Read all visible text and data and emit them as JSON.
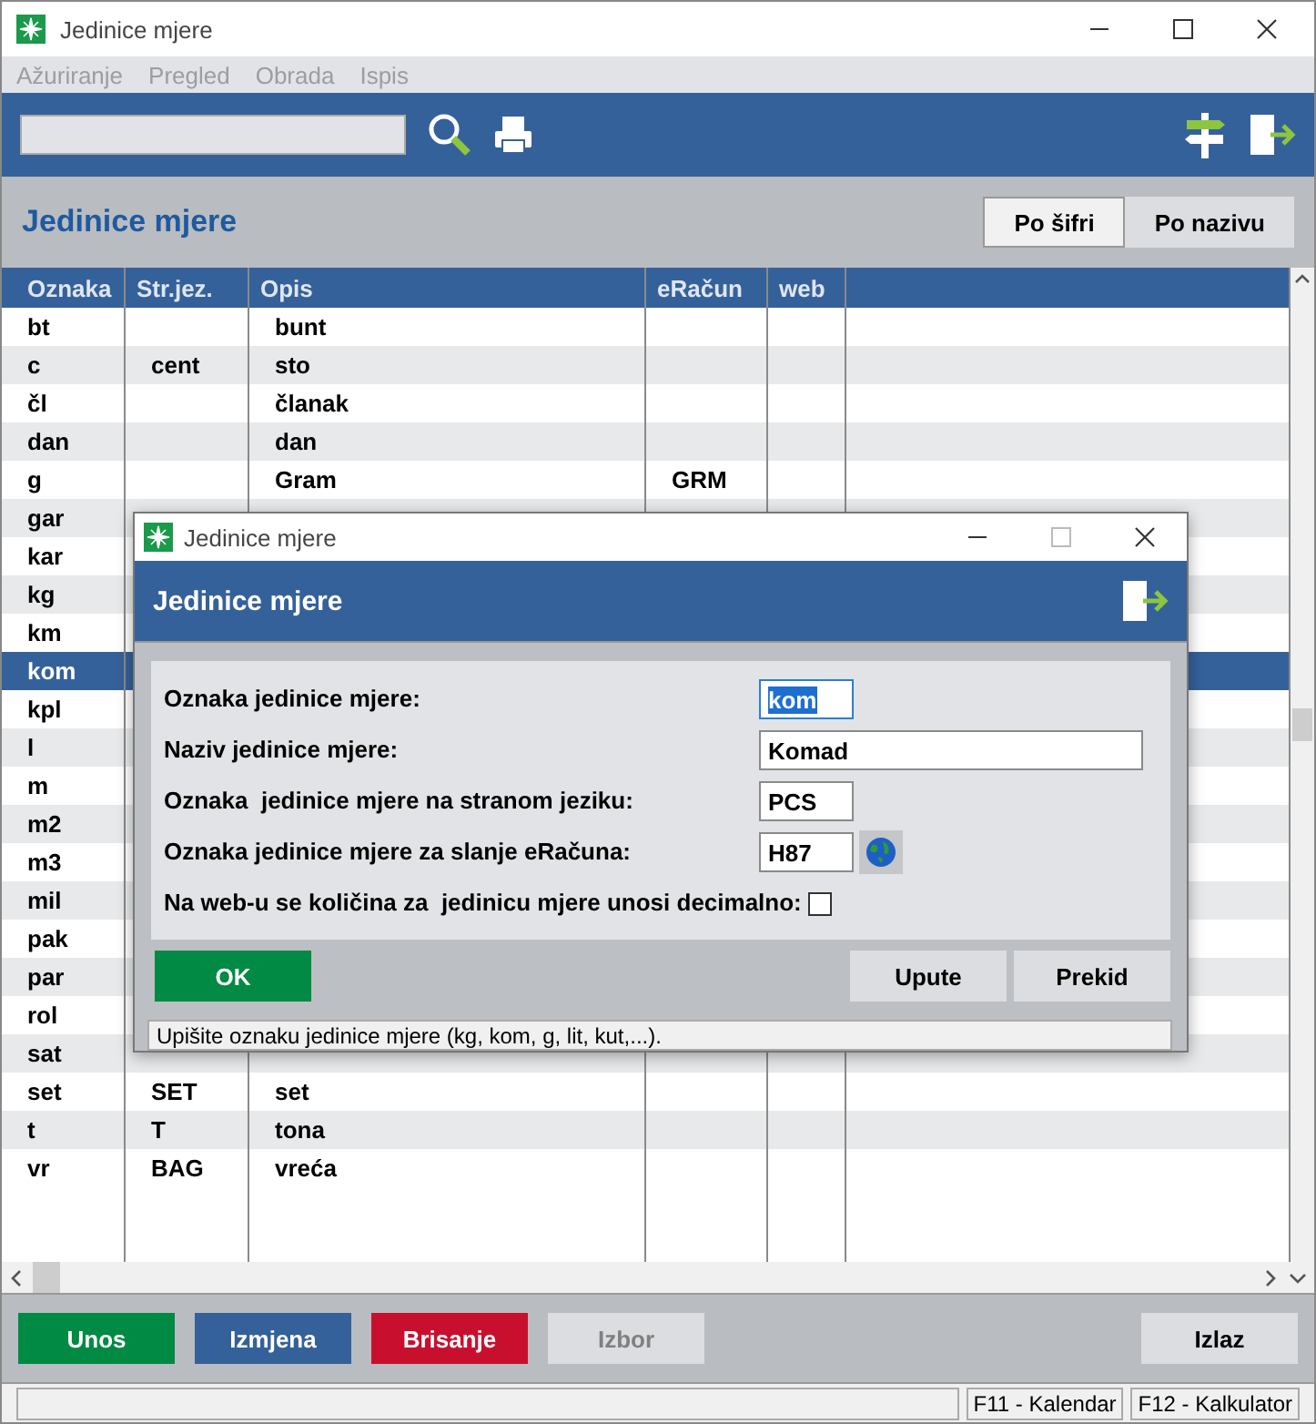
{
  "window": {
    "title": "Jedinice mjere"
  },
  "menu": [
    {
      "label": "Ažuriranje",
      "disabled": true
    },
    {
      "label": "Pregled",
      "disabled": true
    },
    {
      "label": "Obrada",
      "disabled": true
    },
    {
      "label": "Ispis",
      "disabled": true
    }
  ],
  "header": {
    "title": "Jedinice mjere",
    "sort_tabs": [
      {
        "label": "Po šifri",
        "selected": true
      },
      {
        "label": "Po nazivu",
        "selected": false
      }
    ]
  },
  "table": {
    "columns": [
      "Oznaka",
      "Str.jez.",
      "Opis",
      "eRačun",
      "web"
    ],
    "rows": [
      {
        "oznaka": "bt",
        "opis": "bunt",
        "selected": false
      },
      {
        "oznaka": "c",
        "str_jez": "cent",
        "opis": "sto",
        "selected": false
      },
      {
        "oznaka": "čl",
        "opis": "članak",
        "selected": false
      },
      {
        "oznaka": "dan",
        "opis": "dan",
        "selected": false
      },
      {
        "oznaka": "g",
        "opis": "Gram",
        "eracun": "GRM",
        "selected": false
      },
      {
        "oznaka": "gar",
        "selected": false
      },
      {
        "oznaka": "kar",
        "selected": false
      },
      {
        "oznaka": "kg",
        "selected": false
      },
      {
        "oznaka": "km",
        "selected": false
      },
      {
        "oznaka": "kom",
        "selected": true
      },
      {
        "oznaka": "kpl",
        "selected": false
      },
      {
        "oznaka": "l",
        "selected": false
      },
      {
        "oznaka": "m",
        "selected": false
      },
      {
        "oznaka": "m2",
        "selected": false
      },
      {
        "oznaka": "m3",
        "selected": false
      },
      {
        "oznaka": "mil",
        "selected": false
      },
      {
        "oznaka": "pak",
        "selected": false
      },
      {
        "oznaka": "par",
        "selected": false
      },
      {
        "oznaka": "rol",
        "selected": false
      },
      {
        "oznaka": "sat",
        "selected": false
      },
      {
        "oznaka": "set",
        "str_jez": "SET",
        "opis": "set",
        "selected": false
      },
      {
        "oznaka": "t",
        "str_jez": "T",
        "opis": "tona",
        "selected": false
      },
      {
        "oznaka": "vr",
        "str_jez": "BAG",
        "opis": "vreća",
        "selected": false
      }
    ]
  },
  "buttons": [
    {
      "label": "Unos",
      "kind": "add",
      "disabled": false
    },
    {
      "label": "Izmjena",
      "kind": "edit",
      "disabled": false
    },
    {
      "label": "Brisanje",
      "kind": "delete",
      "disabled": false
    },
    {
      "label": "Izbor",
      "kind": "plain",
      "disabled": true
    },
    {
      "label": "Izlaz",
      "kind": "exit",
      "disabled": false
    }
  ],
  "status_bar": [
    "F11 - Kalendar",
    "F12 - Kalkulator"
  ],
  "dialog": {
    "title": "Jedinice mjere",
    "heading": "Jedinice mjere",
    "fields": [
      {
        "label": "Oznaka jedinice mjere:",
        "kind": "text",
        "value": "kom",
        "focused": true,
        "wide": false
      },
      {
        "label": "Naziv jedinice mjere:",
        "kind": "text",
        "value": "Komad",
        "focused": false,
        "wide": true
      },
      {
        "label": "Oznaka  jedinice mjere na stranom jeziku:",
        "kind": "text",
        "value": "PCS",
        "focused": false,
        "wide": false
      },
      {
        "label": "Oznaka jedinice mjere za slanje eRačuna:",
        "kind": "lookup",
        "value": "H87",
        "focused": false,
        "wide": false
      },
      {
        "label": "Na web-u se količina za  jedinicu mjere unosi decimalno:",
        "kind": "checkbox",
        "checked": false
      }
    ],
    "buttons": [
      {
        "label": "OK",
        "kind": "ok"
      },
      {
        "label": "Upute",
        "kind": "plain"
      },
      {
        "label": "Prekid",
        "kind": "plain"
      }
    ],
    "hint": "Upišite oznaku jedinice mjere (kg, kom, g, lit, kut,...)."
  }
}
